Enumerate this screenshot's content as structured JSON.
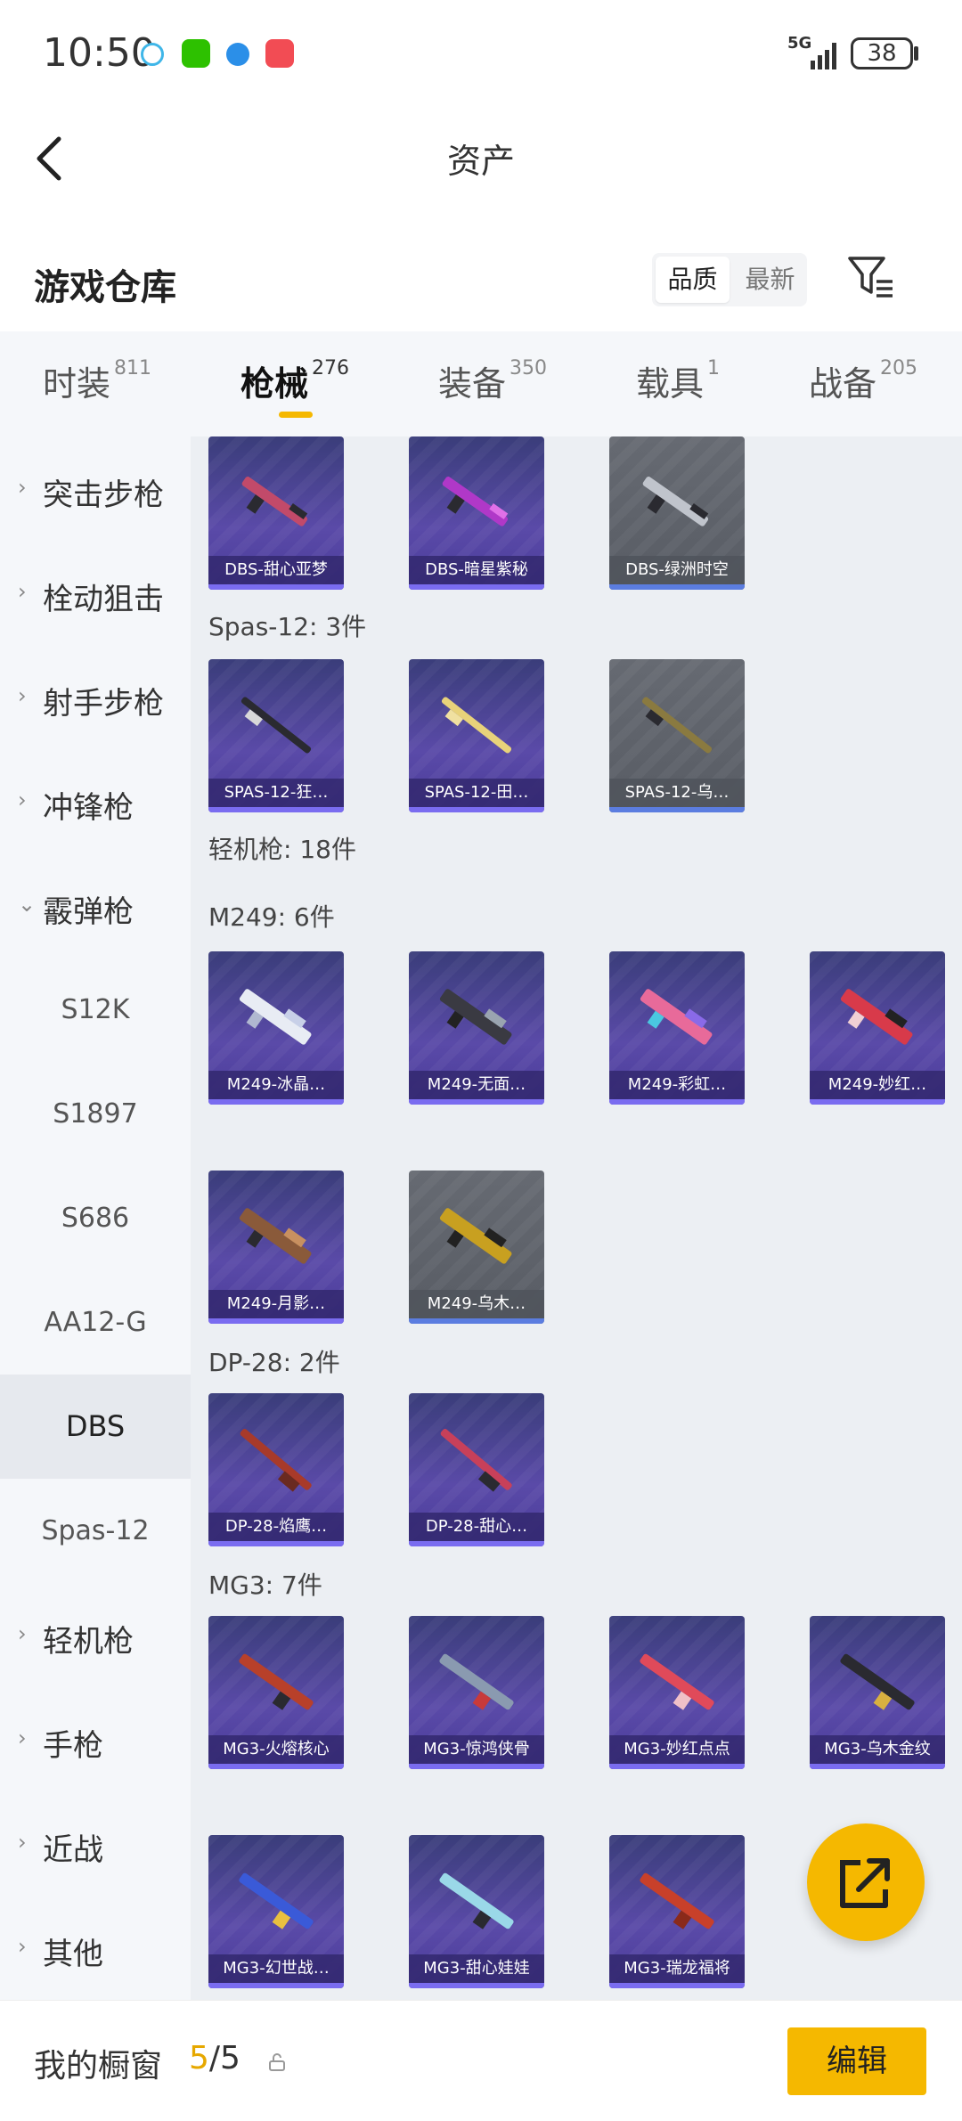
{
  "status_bar": {
    "time": "10:50",
    "network": "5G",
    "battery": "38"
  },
  "header": {
    "title": "资产"
  },
  "warehouse": {
    "title": "游戏仓库",
    "sort_options": [
      "品质",
      "最新"
    ],
    "selected_sort": "品质"
  },
  "tabs": [
    {
      "label": "时装",
      "count": "811"
    },
    {
      "label": "枪械",
      "count": "276"
    },
    {
      "label": "装备",
      "count": "350"
    },
    {
      "label": "载具",
      "count": "1"
    },
    {
      "label": "战备",
      "count": "205"
    }
  ],
  "sidebar": {
    "categories": [
      {
        "label": "突击步枪",
        "arrow": "›"
      },
      {
        "label": "栓动狙击",
        "arrow": "›"
      },
      {
        "label": "射手步枪",
        "arrow": "›"
      },
      {
        "label": "冲锋枪",
        "arrow": "›"
      },
      {
        "label": "霰弹枪",
        "arrow": "⌄"
      }
    ],
    "subitems": [
      "S12K",
      "S1897",
      "S686",
      "AA12-G",
      "DBS",
      "Spas-12"
    ],
    "active_sub": "DBS",
    "more": [
      {
        "label": "轻机枪",
        "arrow": "›"
      },
      {
        "label": "手枪",
        "arrow": "›"
      },
      {
        "label": "近战",
        "arrow": "›"
      },
      {
        "label": "其他",
        "arrow": "›"
      }
    ]
  },
  "content": {
    "dbs_cards": [
      "DBS-甜心亚梦",
      "DBS-暗星紫秘",
      "DBS-绿洲时空"
    ],
    "spas_label": "Spas-12: 3件",
    "spas_cards": [
      "SPAS-12-狂…",
      "SPAS-12-田…",
      "SPAS-12-乌…"
    ],
    "lmg_label": "轻机枪: 18件",
    "m249_label": "M249: 6件",
    "m249_cards": [
      "M249-冰晶…",
      "M249-无面…",
      "M249-彩虹…",
      "M249-妙红…",
      "M249-月影…",
      "M249-乌木…"
    ],
    "dp28_label": "DP-28: 2件",
    "dp28_cards": [
      "DP-28-焰鹰…",
      "DP-28-甜心…"
    ],
    "mg3_label": "MG3: 7件",
    "mg3_cards": [
      "MG3-火熔核心",
      "MG3-惊鸿侠骨",
      "MG3-妙红点点",
      "MG3-乌木金纹",
      "MG3-幻世战…",
      "MG3-甜心娃娃",
      "MG3-瑞龙福将"
    ]
  },
  "bottom_bar": {
    "label": "我的橱窗",
    "count_current": "5",
    "count_sep": "/5",
    "edit_label": "编辑"
  },
  "colors": {
    "accent": "#f5b800",
    "card_purple": "#4a3c9a",
    "card_grey": "#5c6068"
  }
}
